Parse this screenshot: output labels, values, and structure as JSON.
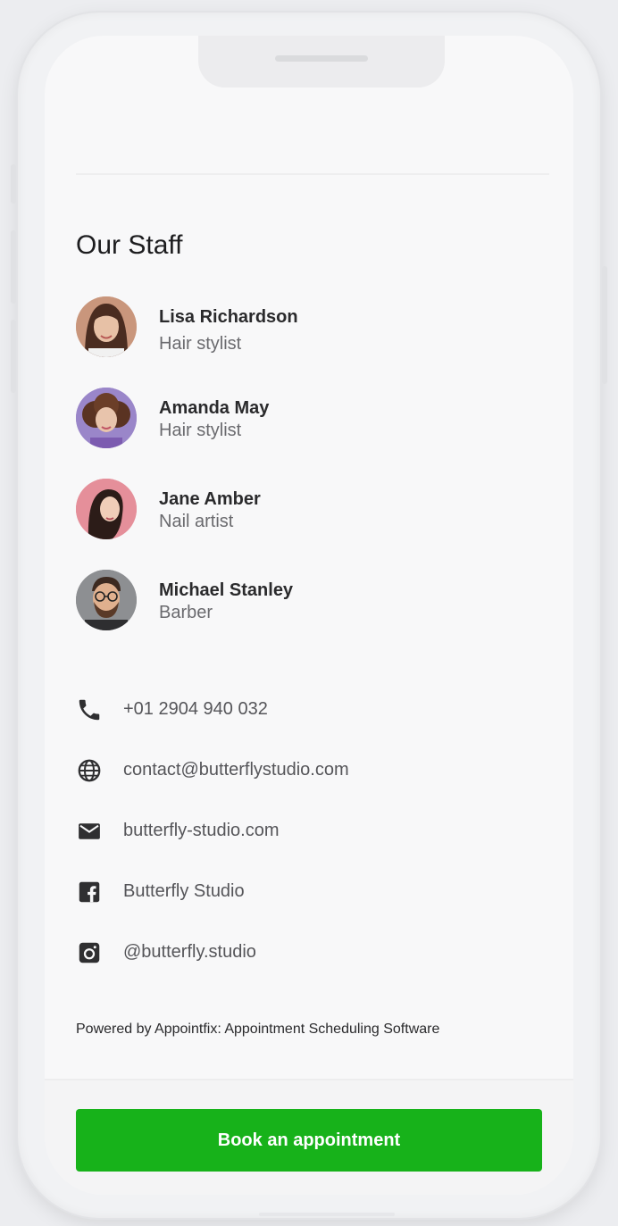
{
  "section_title": "Our Staff",
  "staff": [
    {
      "name": "Lisa Richardson",
      "role": "Hair stylist",
      "avatar_bg": "#d8b09a"
    },
    {
      "name": "Amanda May",
      "role": "Hair stylist",
      "avatar_bg": "#9a86c9"
    },
    {
      "name": "Jane Amber",
      "role": "Nail artist",
      "avatar_bg": "#e58f9a"
    },
    {
      "name": "Michael Stanley",
      "role": "Barber",
      "avatar_bg": "#8d8f92"
    }
  ],
  "contacts": {
    "phone": {
      "icon": "phone-icon",
      "text": "+01 2904 940 032"
    },
    "globe": {
      "icon": "globe-icon",
      "text": "contact@butterflystudio.com"
    },
    "mail": {
      "icon": "mail-icon",
      "text": "butterfly-studio.com"
    },
    "facebook": {
      "icon": "facebook-icon",
      "text": "Butterfly Studio"
    },
    "instagram": {
      "icon": "instagram-icon",
      "text": "@butterfly.studio"
    }
  },
  "footer": {
    "powered_by": "Powered by Appointfix: Appointment Scheduling Software",
    "book_button": "Book an appointment"
  },
  "colors": {
    "accent": "#17b21a",
    "text_primary": "#1d1d1f",
    "text_secondary": "#6a6a6e",
    "screen_bg": "#f8f8f9"
  }
}
